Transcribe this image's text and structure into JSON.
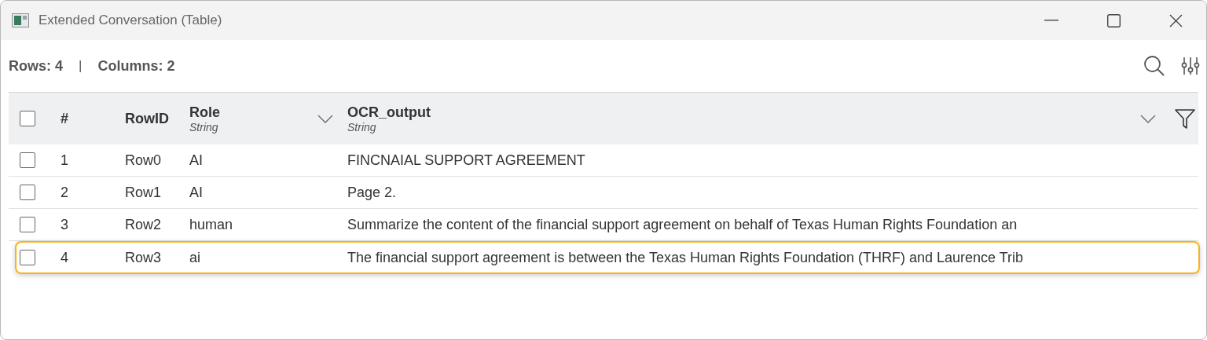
{
  "window": {
    "title": "Extended Conversation (Table)"
  },
  "summary": {
    "rows": "Rows: 4",
    "separator": "|",
    "columns": "Columns: 2"
  },
  "table": {
    "select_all": {
      "checked": false
    },
    "columns": [
      {
        "label": "#"
      },
      {
        "label": "RowID"
      },
      {
        "label": "Role",
        "type": "String"
      },
      {
        "label": "OCR_output",
        "type": "String"
      }
    ],
    "rows": [
      {
        "index": "1",
        "row_id": "Row0",
        "role": "AI",
        "ocr_output": "FINCNAIAL SUPPORT AGREEMENT",
        "checked": false,
        "selected": false
      },
      {
        "index": "2",
        "row_id": "Row1",
        "role": "AI",
        "ocr_output": "Page 2.",
        "checked": false,
        "selected": false
      },
      {
        "index": "3",
        "row_id": "Row2",
        "role": "human",
        "ocr_output": "Summarize the content of the financial support agreement on behalf of Texas Human Rights Foundation an",
        "checked": false,
        "selected": false
      },
      {
        "index": "4",
        "row_id": "Row3",
        "role": "ai",
        "ocr_output": "The financial support agreement is between the Texas Human Rights Foundation (THRF) and Laurence Trib",
        "checked": false,
        "selected": true
      }
    ]
  }
}
